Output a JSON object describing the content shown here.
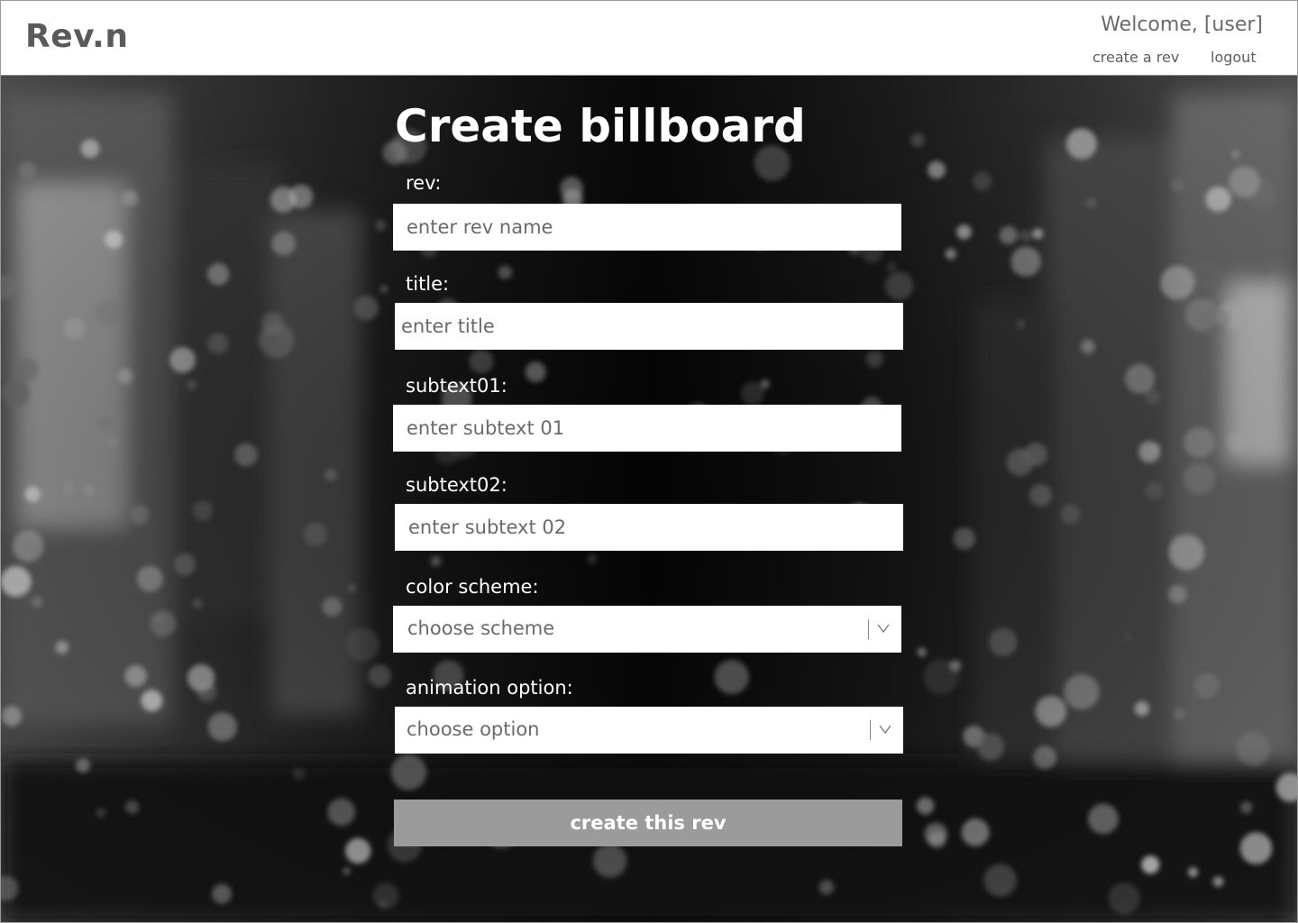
{
  "header": {
    "logo": "Rev.n",
    "welcome": "Welcome, [user]",
    "nav": {
      "create_label": "create a rev",
      "logout_label": "logout"
    }
  },
  "form": {
    "title": "Create billboard",
    "fields": {
      "rev": {
        "label": "rev:",
        "placeholder": "enter rev name"
      },
      "title": {
        "label": "title:",
        "placeholder": "enter title"
      },
      "subtext01": {
        "label": "subtext01:",
        "placeholder": "enter subtext 01"
      },
      "subtext02": {
        "label": "subtext02:",
        "placeholder": "enter subtext 02"
      },
      "color_scheme": {
        "label": "color scheme:",
        "value": "choose scheme",
        "icon": "chevron-down-icon"
      },
      "animation": {
        "label": "animation option:",
        "value": "choose option",
        "icon": "chevron-down-icon"
      }
    },
    "submit_label": "create this rev"
  },
  "colors": {
    "header_bg": "#ffffff",
    "logo": "#5a5a5a",
    "button_bg": "#9b9b9b",
    "page_bg": "#000000"
  }
}
